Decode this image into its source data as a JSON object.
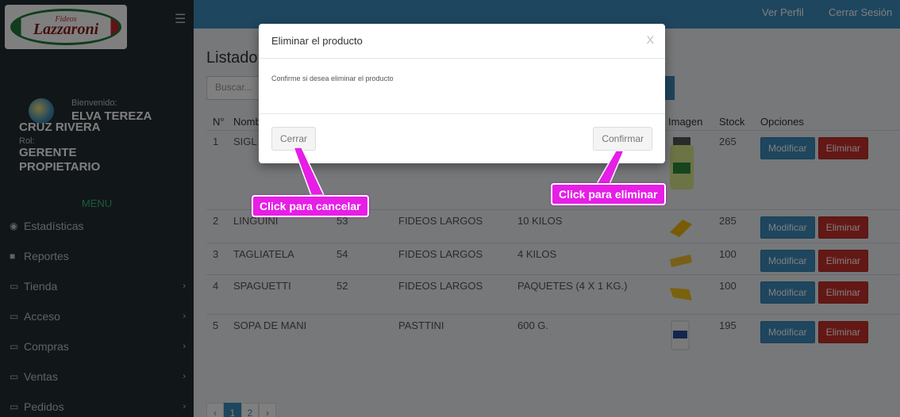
{
  "sidebar": {
    "welcome": "Bienvenido:",
    "user_line1": "ELVA TEREZA",
    "user_line2": "CRUZ RIVERA",
    "rol_label": "Rol:",
    "rol_line1": "GERENTE",
    "rol_line2": "PROPIETARIO",
    "menu_header": "MENU",
    "logo_small": "Fideos",
    "logo_text": "Lazzaroni",
    "items": [
      {
        "label": "Estadísticas",
        "icon": "dashboard-icon",
        "chevron": false
      },
      {
        "label": "Reportes",
        "icon": "folder-icon",
        "chevron": false
      },
      {
        "label": "Tienda",
        "icon": "laptop-icon",
        "chevron": true
      },
      {
        "label": "Acceso",
        "icon": "laptop-icon",
        "chevron": true
      },
      {
        "label": "Compras",
        "icon": "laptop-icon",
        "chevron": true
      },
      {
        "label": "Ventas",
        "icon": "laptop-icon",
        "chevron": true
      },
      {
        "label": "Pedidos",
        "icon": "laptop-icon",
        "chevron": true
      }
    ]
  },
  "topbar": {
    "profile_link": "Ver Perfil",
    "logout_link": "Cerrar Sesión"
  },
  "content": {
    "title": "Listado",
    "search_placeholder": "Buscar...",
    "columns": [
      "N°",
      "Nombre",
      "",
      "",
      "",
      "Imagen",
      "Stock",
      "Opciones"
    ],
    "rows": [
      {
        "n": "1",
        "name": "SIGL",
        "code": "",
        "category": "",
        "presentation": "",
        "stock": "265",
        "img": "bottle"
      },
      {
        "n": "2",
        "name": "LINGUINI",
        "code": "53",
        "category": "FIDEOS LARGOS",
        "presentation": "10 KILOS",
        "stock": "285",
        "img": "pasta"
      },
      {
        "n": "3",
        "name": "TAGLIATELA",
        "code": "54",
        "category": "FIDEOS LARGOS",
        "presentation": "4 KILOS",
        "stock": "100",
        "img": "pasta"
      },
      {
        "n": "4",
        "name": "SPAGUETTI",
        "code": "52",
        "category": "FIDEOS LARGOS",
        "presentation": "PAQUETES (4 X 1 KG.)",
        "stock": "100",
        "img": "pasta"
      },
      {
        "n": "5",
        "name": "SOPA DE MANI",
        "code": "",
        "category": "PASTTINI",
        "presentation": "600 G.",
        "stock": "195",
        "img": "bag"
      }
    ],
    "modify_label": "Modificar",
    "delete_label": "Eliminar",
    "pagination": [
      "‹",
      "1",
      "2",
      "›"
    ]
  },
  "modal": {
    "title": "Eliminar el producto",
    "close": "X",
    "body": "Confirme si desea eliminar el producto",
    "cancel_label": "Cerrar",
    "confirm_label": "Confirmar"
  },
  "callouts": {
    "cancel": "Click para cancelar",
    "confirm": "Click para eliminar"
  },
  "colors": {
    "sidebar": "#222d32",
    "primary": "#3c8dbc",
    "danger": "#c9302c",
    "callout": "#e61ee6"
  }
}
